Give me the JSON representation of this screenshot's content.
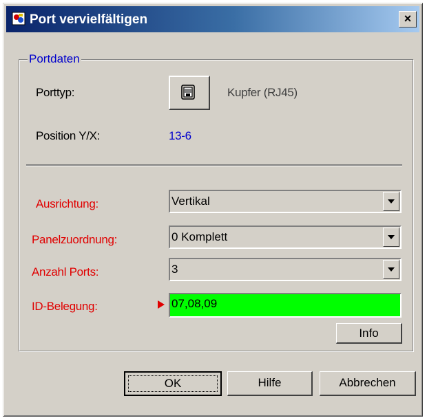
{
  "window": {
    "title": "Port vervielfältigen",
    "close_label": "×"
  },
  "group": {
    "legend": "Portdaten"
  },
  "fields": {
    "porttyp_label": "Porttyp:",
    "porttyp_value": "Kupfer (RJ45)",
    "position_label": "Position Y/X:",
    "position_value": "13-6",
    "ausrichtung_label": "Ausrichtung:",
    "ausrichtung_value": "Vertikal",
    "panelzuordnung_label": "Panelzuordnung:",
    "panelzuordnung_value": "0 Komplett",
    "anzahl_label": "Anzahl Ports:",
    "anzahl_value": "3",
    "idbelegung_label": "ID-Belegung:",
    "idbelegung_value": "07,08,09"
  },
  "buttons": {
    "info": "Info",
    "ok": "OK",
    "hilfe": "Hilfe",
    "abbrechen": "Abbrechen"
  },
  "colors": {
    "required_label": "#e00000",
    "id_field_bg": "#00ff00",
    "value_blue": "#0000cc"
  },
  "icons": {
    "app": "app-icon",
    "porttype": "rj45-port-icon",
    "dropdown": "chevron-down-icon",
    "marker": "triangle-right-icon"
  }
}
